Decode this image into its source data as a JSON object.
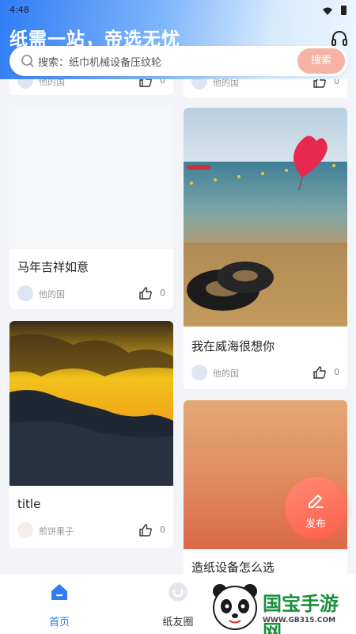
{
  "status": {
    "time": "4:48"
  },
  "header": {
    "slogan": "纸需一站，帝选无忧",
    "headset_icon": "headset-icon"
  },
  "search": {
    "placeholder": "搜索：纸巾机械设备压纹轮",
    "button_label": "搜索",
    "icon": "search-icon"
  },
  "feed": {
    "top_partial": [
      {
        "author": "他的国",
        "likes": "0"
      },
      {
        "author": "他的国",
        "likes": "0"
      }
    ],
    "cards": [
      {
        "title": "马年吉祥如意",
        "author": "他的国",
        "likes": "0"
      },
      {
        "title": "我在威海很想你",
        "author": "他的国",
        "likes": "0"
      },
      {
        "title": "title",
        "author": "煎饼果子",
        "likes": "0"
      },
      {
        "title": "造纸设备怎么选",
        "author": "",
        "likes": ""
      }
    ]
  },
  "fab": {
    "label": "发布",
    "icon": "pen-icon"
  },
  "nav": {
    "items": [
      {
        "label": "首页",
        "icon": "home-icon",
        "active": true
      },
      {
        "label": "纸友圈",
        "icon": "circle-icon",
        "active": false
      }
    ]
  },
  "watermark": {
    "title": "国宝手游网",
    "url": "WWW.GB315.COM"
  },
  "colors": {
    "accent": "#2f7cf6",
    "search_button": "#f5b3a3",
    "fab": "#ff5e4d",
    "nav_active": "#2f7cf6"
  }
}
